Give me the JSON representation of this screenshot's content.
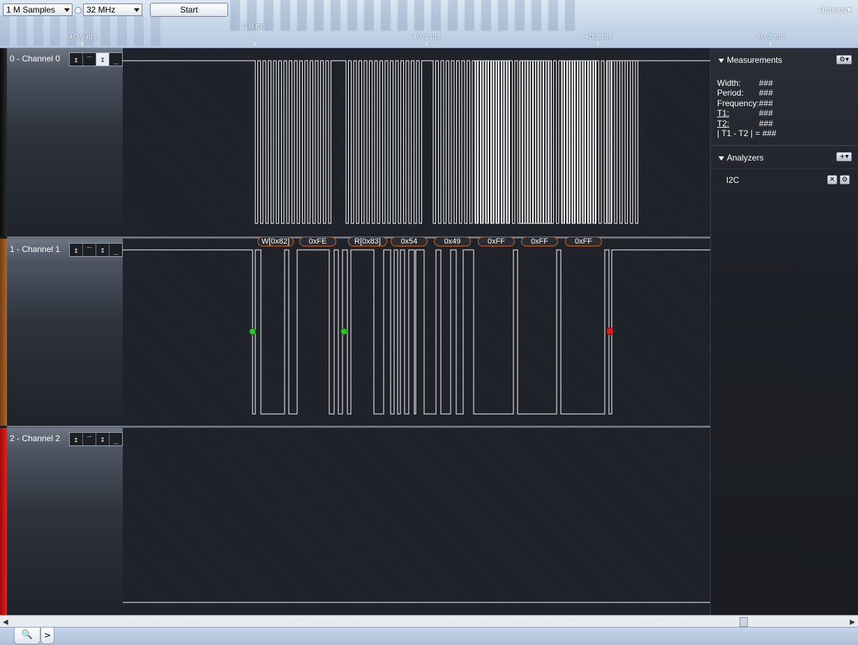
{
  "toolbar": {
    "samples_value": "1 M Samples",
    "rate_value": "32 MHz",
    "start_label": "Start",
    "options_label": "Options",
    "options_arrow": "▾"
  },
  "ruler": {
    "labels": [
      "+0.9 ms",
      "0.0 ms",
      "+0.1 ms",
      "+0.2 ms",
      "+0.3 ms"
    ]
  },
  "channels": [
    {
      "name": "0 - Channel 0",
      "color": "#e8e8e8",
      "trigger_icons": [
        "↥",
        "‾",
        "↧",
        "_"
      ],
      "active_trigger": 2
    },
    {
      "name": "1 - Channel 1",
      "color": "#b8681f",
      "trigger_icons": [
        "↥",
        "‾",
        "↧",
        "_"
      ],
      "active_trigger": -1
    },
    {
      "name": "2 - Channel 2",
      "color": "#e8191b",
      "trigger_icons": [
        "↥",
        "‾",
        "↧",
        "_"
      ],
      "active_trigger": -1
    }
  ],
  "decodes": [
    "W[0x82]",
    "0xFE",
    "R[0x83]",
    "0x54",
    "0x49",
    "0xFF",
    "0xFF",
    "0xFF"
  ],
  "markers": {
    "start_color": "#29c72c",
    "stop_color": "#e01b1b"
  },
  "measurements": {
    "title": "Measurements",
    "rows": [
      {
        "key": "Width:",
        "value": "###"
      },
      {
        "key": "Period:",
        "value": "###"
      },
      {
        "key": "Frequency:",
        "value": "###"
      },
      {
        "key": "T1:",
        "value": "###"
      },
      {
        "key": "T2:",
        "value": "###"
      }
    ],
    "diff_row": "| T1 - T2 | = ###"
  },
  "analyzers": {
    "title": "Analyzers",
    "items": [
      {
        "name": "I2C"
      }
    ]
  },
  "statusbar": {
    "search_icon": "🔍",
    "next_label": ">"
  }
}
